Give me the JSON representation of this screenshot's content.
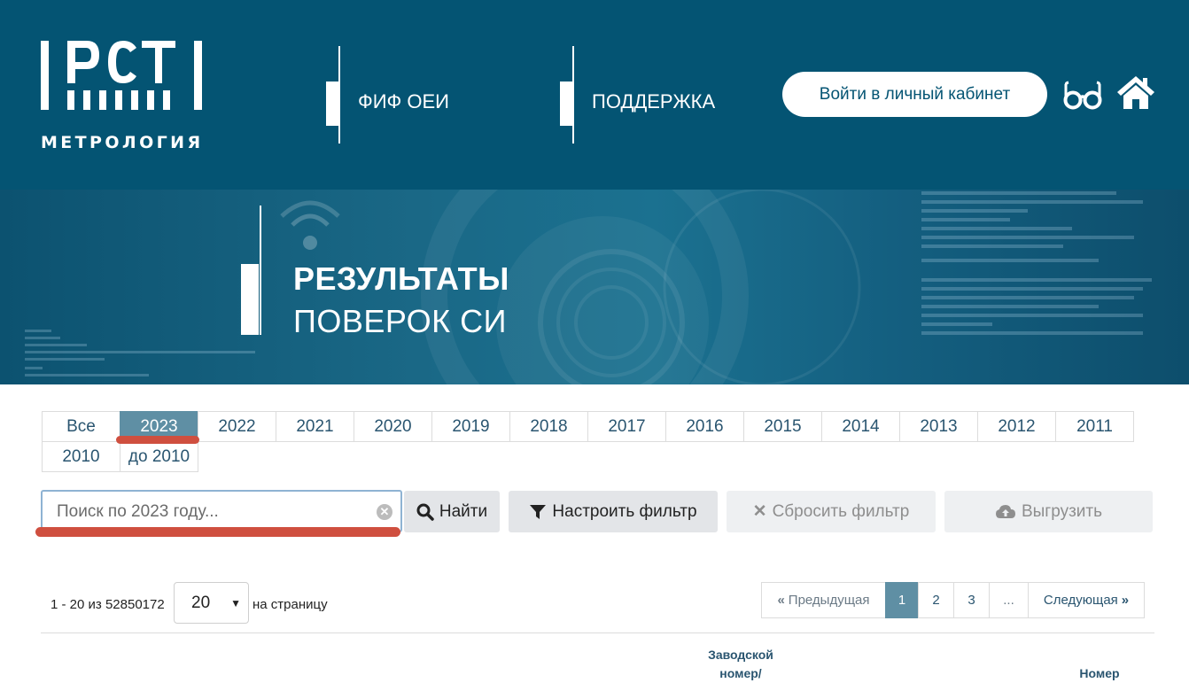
{
  "header": {
    "logo_text": "МЕТРОЛОГИЯ",
    "logo_mark": "РСТ",
    "nav": [
      {
        "label": "ФИФ ОЕИ"
      },
      {
        "label": "ПОДДЕРЖКА"
      }
    ],
    "login_label": "Войти в личный кабинет",
    "icons": [
      "glasses-icon",
      "home-icon"
    ],
    "background_color": "#045473"
  },
  "banner": {
    "title_bold": "РЕЗУЛЬТАТЫ",
    "title_light": "ПОВЕРОК СИ"
  },
  "year_tabs": {
    "active": "2023",
    "items": [
      "Все",
      "2023",
      "2022",
      "2021",
      "2020",
      "2019",
      "2018",
      "2017",
      "2016",
      "2015",
      "2014",
      "2013",
      "2012",
      "2011",
      "2010",
      "до 2010"
    ]
  },
  "search": {
    "placeholder": "Поиск по 2023 году...",
    "find_label": "Найти",
    "filter_label": "Настроить фильтр",
    "reset_label": "Сбросить фильтр",
    "export_label": "Выгрузить"
  },
  "results": {
    "range_text": "1 - 20 из 52850172",
    "per_page_value": "20",
    "per_page_label": "на страницу"
  },
  "pagination": {
    "prev_label": "Предыдущая",
    "pages": [
      "1",
      "2",
      "3",
      "..."
    ],
    "current": "1",
    "next_label": "Следующая"
  },
  "table": {
    "columns": [
      {
        "label": "Заводской номер/"
      },
      {
        "label": "Номер"
      }
    ]
  },
  "colors": {
    "accent": "#5f8fa4",
    "annotation_red": "#cf4f3f",
    "link_text": "#2a5570"
  }
}
